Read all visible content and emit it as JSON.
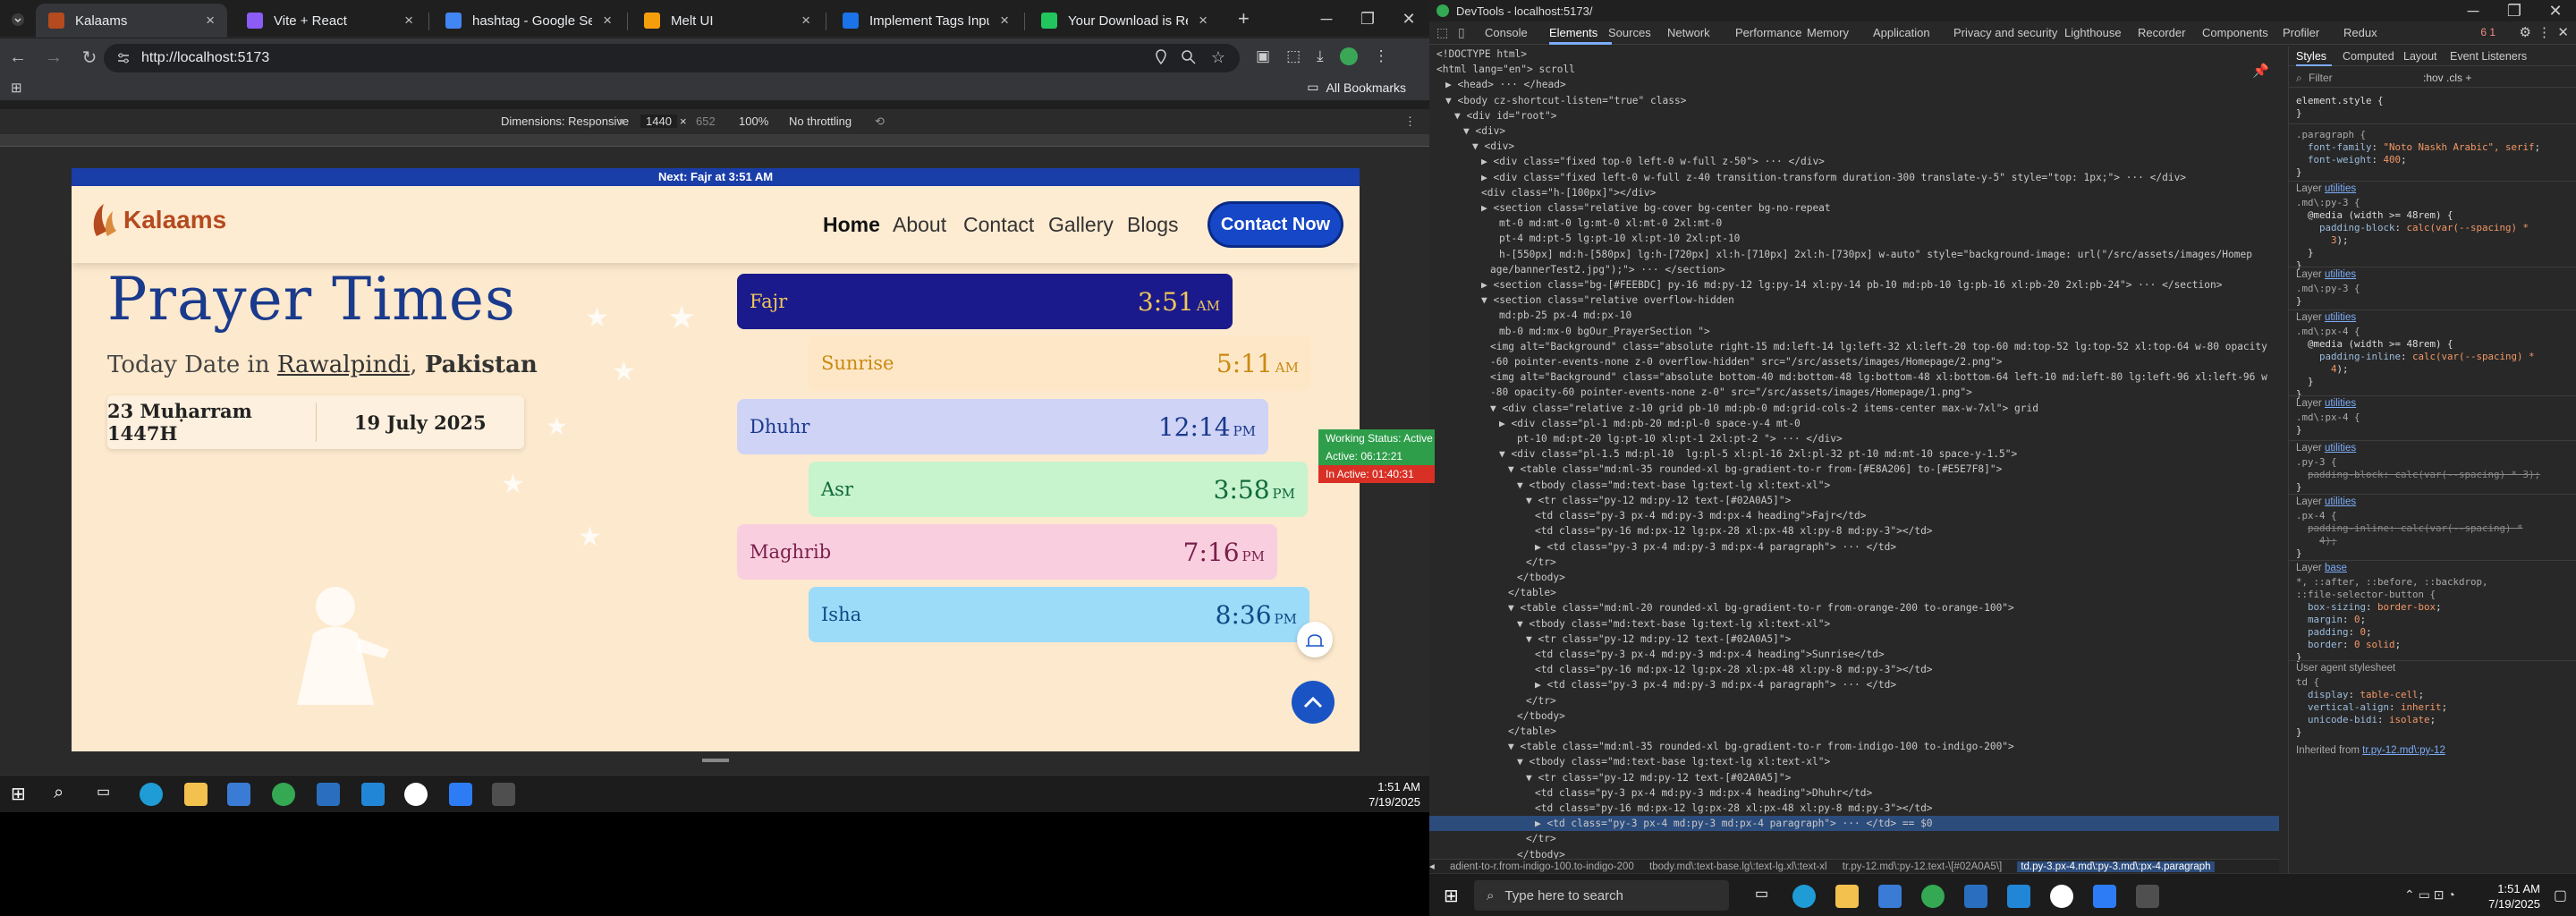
{
  "browser": {
    "tabs": [
      {
        "title": "Kalaams",
        "color": "#b54a1f",
        "active": true
      },
      {
        "title": "Vite + React",
        "color": "#8b5cf6",
        "active": false
      },
      {
        "title": "hashtag - Google Search",
        "color": "#4285f4",
        "active": false
      },
      {
        "title": "Melt UI",
        "color": "#f59e0b",
        "active": false
      },
      {
        "title": "Implement Tags Input in Blo",
        "color": "#1a73e8",
        "active": false
      },
      {
        "title": "Your Download is Ready",
        "color": "#22c55e",
        "active": false
      }
    ],
    "new_tab": "+",
    "url": "http://localhost:5173",
    "all_bookmarks": "All Bookmarks",
    "device_bar": {
      "dimensions_label": "Dimensions: Responsive",
      "width": "1440",
      "times": "×",
      "height": "652",
      "zoom": "100%",
      "throttle": "No throttling"
    }
  },
  "site": {
    "announcement": "Next: Fajr at 3:51 AM",
    "logo_text": "Kalaams",
    "nav": [
      "Home",
      "About",
      "Contact",
      "Gallery",
      "Blogs"
    ],
    "cta": "Contact Now",
    "title": "Prayer Times",
    "today_prefix": "Today Date in",
    "city": "Rawalpindi",
    "country": "Pakistan",
    "hijri_date": "23 Muḥarram 1447H",
    "gregorian_date": "19 July 2025",
    "prayers": [
      {
        "name": "Fajr",
        "time": "3:51",
        "period": "AM",
        "bg": "#1a1a8c",
        "fg": "#f0c75a"
      },
      {
        "name": "Sunrise",
        "time": "5:11",
        "period": "AM",
        "bg": "#fde7c7",
        "fg": "#c98a10"
      },
      {
        "name": "Dhuhr",
        "time": "12:14",
        "period": "PM",
        "bg": "#cfd3f6",
        "fg": "#1a3a8c"
      },
      {
        "name": "Asr",
        "time": "3:58",
        "period": "PM",
        "bg": "#c7f3cd",
        "fg": "#106a3a"
      },
      {
        "name": "Maghrib",
        "time": "7:16",
        "period": "PM",
        "bg": "#f9cfe0",
        "fg": "#7a1f4a"
      },
      {
        "name": "Isha",
        "time": "8:36",
        "period": "PM",
        "bg": "#9ddcf8",
        "fg": "#0d4a86"
      }
    ]
  },
  "devtools": {
    "title": "DevTools - localhost:5173/",
    "tabs": [
      "Console",
      "Elements",
      "Sources",
      "Network",
      "Performance",
      "Memory",
      "Application",
      "Privacy and security",
      "Lighthouse",
      "Recorder",
      "Components",
      "Profiler",
      "Redux"
    ],
    "badges": "6  1",
    "code_lines": [
      {
        "i": 0,
        "t": "<!DOCTYPE html>"
      },
      {
        "i": 0,
        "t": "<html lang=\"en\"> scroll"
      },
      {
        "i": 1,
        "t": "▶ <head> ··· </head>"
      },
      {
        "i": 1,
        "t": "▼ <body cz-shortcut-listen=\"true\" class>"
      },
      {
        "i": 2,
        "t": "▼ <div id=\"root\">"
      },
      {
        "i": 3,
        "t": "▼ <div>"
      },
      {
        "i": 4,
        "t": "▼ <div>"
      },
      {
        "i": 5,
        "t": "▶ <div class=\"fixed top-0 left-0 w-full z-50\"> ··· </div>"
      },
      {
        "i": 5,
        "t": "▶ <div class=\"fixed left-0 w-full z-40 transition-transform duration-300 translate-y-5\" style=\"top: 1px;\"> ··· </div>"
      },
      {
        "i": 5,
        "t": "<div class=\"h-[100px]\"></div>"
      },
      {
        "i": 5,
        "t": "▶ <section class=\"relative bg-cover bg-center bg-no-repeat"
      },
      {
        "i": 7,
        "t": "mt-0 md:mt-0 lg:mt-0 xl:mt-0 2xl:mt-0"
      },
      {
        "i": 7,
        "t": "pt-4 md:pt-5 lg:pt-10 xl:pt-10 2xl:pt-10"
      },
      {
        "i": 7,
        "t": "h-[550px] md:h-[580px] lg:h-[720px] xl:h-[710px] 2xl:h-[730px] w-auto\" style=\"background-image: url(\"/src/assets/images/Homep"
      },
      {
        "i": 6,
        "t": "age/bannerTest2.jpg\");\"> ··· </section>"
      },
      {
        "i": 5,
        "t": "▶ <section class=\"bg-[#FEEBDC] py-16 md:py-12 lg:py-14 xl:py-14 pb-10 md:pb-10 lg:pb-16 xl:pb-20 2xl:pb-24\"> ··· </section>"
      },
      {
        "i": 5,
        "t": "▼ <section class=\"relative overflow-hidden"
      },
      {
        "i": 7,
        "t": "md:pb-25 px-4 md:px-10"
      },
      {
        "i": 7,
        "t": "mb-0 md:mx-0 bgOur_PrayerSection \">"
      },
      {
        "i": 6,
        "t": "<img alt=\"Background\" class=\"absolute right-15 md:left-14 lg:left-32 xl:left-20 top-60 md:top-52 lg:top-52 xl:top-64 w-80 opacity"
      },
      {
        "i": 6,
        "t": "-60 pointer-events-none z-0 overflow-hidden\" src=\"/src/assets/images/Homepage/2.png\">"
      },
      {
        "i": 6,
        "t": "<img alt=\"Background\" class=\"absolute bottom-40 md:bottom-48 lg:bottom-48 xl:bottom-64 left-10 md:left-80 lg:left-96 xl:left-96 w"
      },
      {
        "i": 6,
        "t": "-80 opacity-60 pointer-events-none z-0\" src=\"/src/assets/images/Homepage/1.png\">"
      },
      {
        "i": 6,
        "t": "▼ <div class=\"relative z-10 grid pb-10 md:pb-0 md:grid-cols-2 items-center max-w-7xl\"> grid"
      },
      {
        "i": 7,
        "t": "▶ <div class=\"pl-1 md:pb-20 md:pl-0 space-y-4 mt-0"
      },
      {
        "i": 9,
        "t": "pt-10 md:pt-20 lg:pt-10 xl:pt-1 2xl:pt-2 \"> ··· </div>"
      },
      {
        "i": 7,
        "t": "▼ <div class=\"pl-1.5 md:pl-10  lg:pl-5 xl:pl-16 2xl:pl-32 pt-10 md:mt-10 space-y-1.5\">"
      },
      {
        "i": 8,
        "t": "▼ <table class=\"md:ml-35 rounded-xl bg-gradient-to-r from-[#E8A206] to-[#E5E7F8]\">"
      },
      {
        "i": 9,
        "t": "▼ <tbody class=\"md:text-base lg:text-lg xl:text-xl\">"
      },
      {
        "i": 10,
        "t": "▼ <tr class=\"py-12 md:py-12 text-[#02A0A5]\">"
      },
      {
        "i": 11,
        "t": "<td class=\"py-3 px-4 md:py-3 md:px-4 heading\">Fajr</td>"
      },
      {
        "i": 11,
        "t": "<td class=\"py-16 md:px-12 lg:px-28 xl:px-48 xl:py-8 md:py-3\"></td>"
      },
      {
        "i": 11,
        "t": "▶ <td class=\"py-3 px-4 md:py-3 md:px-4 paragraph\"> ··· </td>"
      },
      {
        "i": 10,
        "t": "</tr>"
      },
      {
        "i": 9,
        "t": "</tbody>"
      },
      {
        "i": 8,
        "t": "</table>"
      },
      {
        "i": 8,
        "t": "▼ <table class=\"md:ml-20 rounded-xl bg-gradient-to-r from-orange-200 to-orange-100\">"
      },
      {
        "i": 9,
        "t": "▼ <tbody class=\"md:text-base lg:text-lg xl:text-xl\">"
      },
      {
        "i": 10,
        "t": "▼ <tr class=\"py-12 md:py-12 text-[#02A0A5]\">"
      },
      {
        "i": 11,
        "t": "<td class=\"py-3 px-4 md:py-3 md:px-4 heading\">Sunrise</td>"
      },
      {
        "i": 11,
        "t": "<td class=\"py-16 md:px-12 lg:px-28 xl:px-48 xl:py-8 md:py-3\"></td>"
      },
      {
        "i": 11,
        "t": "▶ <td class=\"py-3 px-4 md:py-3 md:px-4 paragraph\"> ··· </td>"
      },
      {
        "i": 10,
        "t": "</tr>"
      },
      {
        "i": 9,
        "t": "</tbody>"
      },
      {
        "i": 8,
        "t": "</table>"
      },
      {
        "i": 8,
        "t": "▼ <table class=\"md:ml-35 rounded-xl bg-gradient-to-r from-indigo-100 to-indigo-200\">"
      },
      {
        "i": 9,
        "t": "▼ <tbody class=\"md:text-base lg:text-lg xl:text-xl\">"
      },
      {
        "i": 10,
        "t": "▼ <tr class=\"py-12 md:py-12 text-[#02A0A5]\">"
      },
      {
        "i": 11,
        "t": "<td class=\"py-3 px-4 md:py-3 md:px-4 heading\">Dhuhr</td>"
      },
      {
        "i": 11,
        "t": "<td class=\"py-16 md:px-12 lg:px-28 xl:px-48 xl:py-8 md:py-3\"></td>"
      },
      {
        "i": 11,
        "t": "▶ <td class=\"py-3 px-4 md:py-3 md:px-4 paragraph\"> ··· </td> == $0",
        "sel": true
      },
      {
        "i": 10,
        "t": "</tr>"
      },
      {
        "i": 9,
        "t": "</tbody>"
      }
    ],
    "breadcrumb": [
      "adient-to-r.from-indigo-100.to-indigo-200",
      "tbody.md\\:text-base.lg\\:text-lg.xl\\:text-xl",
      "tr.py-12.md\\:py-12.text-\\[#02A0A5\\]",
      "td.py-3.px-4.md\\:py-3.md\\:px-4.paragraph"
    ],
    "styles_tabs": [
      "Styles",
      "Computed",
      "Layout",
      "Event Listeners"
    ],
    "filter_placeholder": "Filter",
    "filter_tools": ":hov  .cls  +",
    "status": [
      {
        "text": "Working Status: Active",
        "bg": "#2e9e4a"
      },
      {
        "text": "Active: 06:12:21",
        "bg": "#2e9e4a"
      },
      {
        "text": "In Active: 01:40:31",
        "bg": "#d93025"
      }
    ]
  },
  "taskbar": {
    "search_placeholder": "Type here to search",
    "time": "1:51 AM",
    "date": "7/19/2025"
  }
}
